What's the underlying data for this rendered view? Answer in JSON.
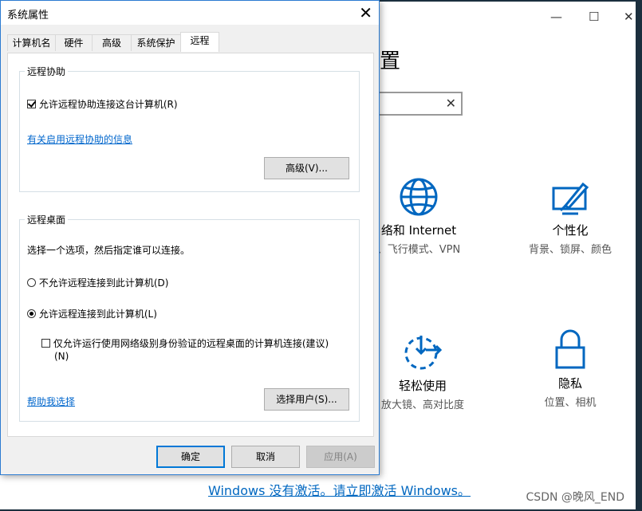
{
  "settings": {
    "title_fragment": "置",
    "search_clear": "✕",
    "tiles": [
      {
        "name": "络和 Internet",
        "desc": "、飞行模式、VPN",
        "icon": "globe-icon"
      },
      {
        "name": "个性化",
        "desc": "背景、锁屏、颜色",
        "icon": "personalization-icon"
      },
      {
        "name": "轻松使用",
        "desc": "放大镜、高对比度",
        "icon": "ease-of-access-icon"
      },
      {
        "name": "隐私",
        "desc": "位置、相机",
        "icon": "lock-icon"
      }
    ],
    "activate_text": "Windows 没有激活。请立即激活 Windows。",
    "watermark": "CSDN @晚风_END",
    "window_controls": {
      "minimize": "—",
      "maximize": "☐",
      "close": "✕"
    }
  },
  "dialog": {
    "title": "系统属性",
    "close_glyph": "✕",
    "tabs": [
      "计算机名",
      "硬件",
      "高级",
      "系统保护",
      "远程"
    ],
    "active_tab": "远程",
    "remote_assistance": {
      "legend": "远程协助",
      "allow_label": "允许远程协助连接这台计算机(R)",
      "allow_checked": true,
      "info_link": "有关启用远程协助的信息",
      "advanced_button": "高级(V)..."
    },
    "remote_desktop": {
      "legend": "远程桌面",
      "instruction": "选择一个选项，然后指定谁可以连接。",
      "option_deny": "不允许远程连接到此计算机(D)",
      "option_allow": "允许远程连接到此计算机(L)",
      "selected": "allow",
      "nla_label_line1": "仅允许运行使用网络级别身份验证的远程桌面的计算机连接(建议)",
      "nla_label_line2": "(N)",
      "nla_checked": false,
      "help_link": "帮助我选择",
      "select_users_button": "选择用户(S)..."
    },
    "buttons": {
      "ok": "确定",
      "cancel": "取消",
      "apply": "应用(A)"
    }
  }
}
